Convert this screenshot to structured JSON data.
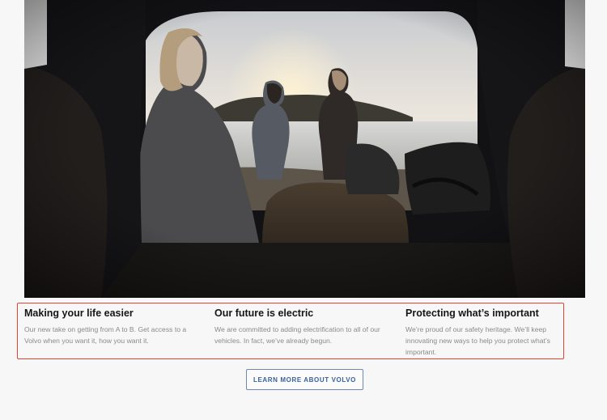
{
  "hero": {
    "image_description_icon": "car-trunk-sunset-photo-icon"
  },
  "features": [
    {
      "title": "Making your life easier",
      "body": "Our new take on getting from A to B. Get access to a Volvo when you want it, how you want it."
    },
    {
      "title": "Our future is electric",
      "body": "We are committed to adding electrification to all of our vehicles. In fact, we’ve already begun."
    },
    {
      "title": "Protecting what’s important",
      "body": "We’re proud of our safety heritage. We’ll keep innovating new ways to help you protect what’s important."
    }
  ],
  "cta": {
    "label": "LEARN MORE ABOUT VOLVO"
  },
  "colors": {
    "highlight_border": "#e4442f",
    "cta_text": "#3a5f9b",
    "cta_border": "#6d87b8"
  }
}
